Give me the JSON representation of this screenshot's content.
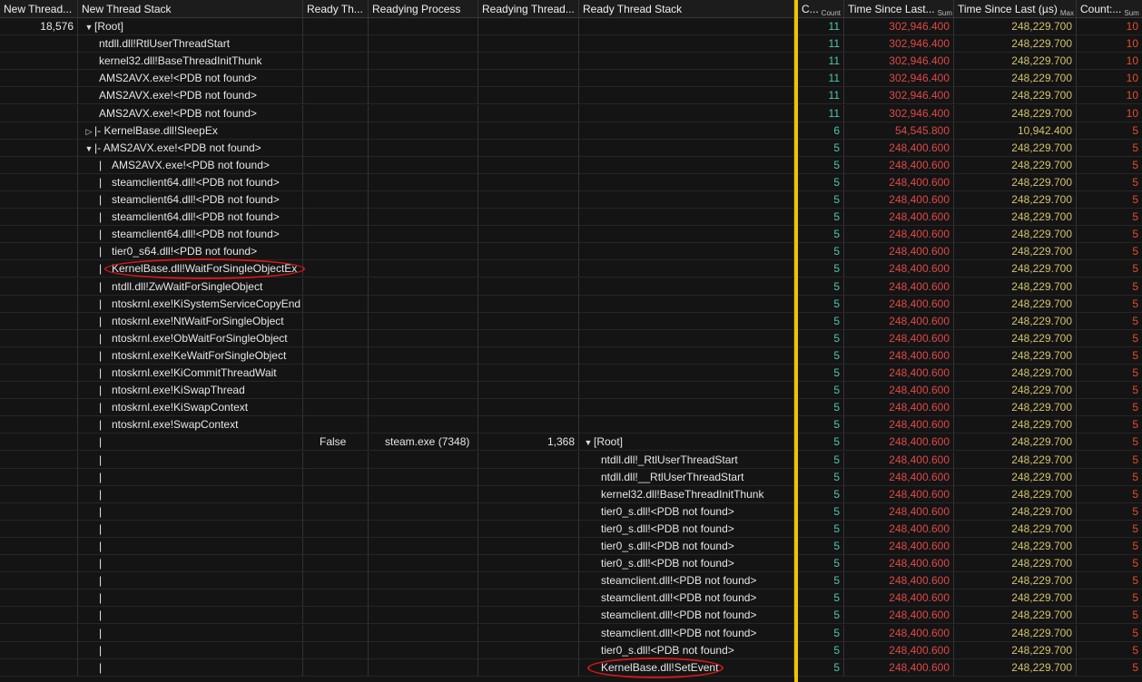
{
  "columns": {
    "new_thread": "New Thread...",
    "new_thread_stack": "New Thread Stack",
    "ready_thread": "Ready Th...",
    "readying_process": "Readying Process",
    "readying_thread": "Readying Thread...",
    "ready_thread_stack": "Ready Thread Stack",
    "count": "C...",
    "count_sub": "Count",
    "time_sum": "Time Since Last...",
    "time_sum_sub": "Sum",
    "time_max": "Time Since Last (µs)",
    "time_max_sub": "Max",
    "count_sum": "Count:...",
    "count_sum_sub": "Sum"
  },
  "rows": [
    {
      "nt": "18,576",
      "depth": 0,
      "pipe": false,
      "tw": "▼",
      "frame": "[Root]",
      "rt": "",
      "rp": "",
      "rth": "",
      "rtw": "",
      "rframe": "",
      "cnt": "11",
      "tsum": "302,946.400",
      "tmax": "248,229.700",
      "csum": "10"
    },
    {
      "nt": "",
      "depth": 1,
      "pipe": false,
      "tw": "",
      "frame": "ntdll.dll!RtlUserThreadStart",
      "rt": "",
      "rp": "",
      "rth": "",
      "rtw": "",
      "rframe": "",
      "cnt": "11",
      "tsum": "302,946.400",
      "tmax": "248,229.700",
      "csum": "10"
    },
    {
      "nt": "",
      "depth": 1,
      "pipe": false,
      "tw": "",
      "frame": "kernel32.dll!BaseThreadInitThunk",
      "rt": "",
      "rp": "",
      "rth": "",
      "rtw": "",
      "rframe": "",
      "cnt": "11",
      "tsum": "302,946.400",
      "tmax": "248,229.700",
      "csum": "10"
    },
    {
      "nt": "",
      "depth": 1,
      "pipe": false,
      "tw": "",
      "frame": "AMS2AVX.exe!<PDB not found>",
      "rt": "",
      "rp": "",
      "rth": "",
      "rtw": "",
      "rframe": "",
      "cnt": "11",
      "tsum": "302,946.400",
      "tmax": "248,229.700",
      "csum": "10"
    },
    {
      "nt": "",
      "depth": 1,
      "pipe": false,
      "tw": "",
      "frame": "AMS2AVX.exe!<PDB not found>",
      "rt": "",
      "rp": "",
      "rth": "",
      "rtw": "",
      "rframe": "",
      "cnt": "11",
      "tsum": "302,946.400",
      "tmax": "248,229.700",
      "csum": "10"
    },
    {
      "nt": "",
      "depth": 1,
      "pipe": false,
      "tw": "",
      "frame": "AMS2AVX.exe!<PDB not found>",
      "rt": "",
      "rp": "",
      "rth": "",
      "rtw": "",
      "rframe": "",
      "cnt": "11",
      "tsum": "302,946.400",
      "tmax": "248,229.700",
      "csum": "10"
    },
    {
      "nt": "",
      "depth": 0,
      "pipe": false,
      "tw": "▷",
      "frame": "|- KernelBase.dll!SleepEx",
      "rt": "",
      "rp": "",
      "rth": "",
      "rtw": "",
      "rframe": "",
      "cnt": "6",
      "tsum": "54,545.800",
      "tmax": "10,942.400",
      "csum": "5"
    },
    {
      "nt": "",
      "depth": 0,
      "pipe": false,
      "tw": "▼",
      "frame": "|- AMS2AVX.exe!<PDB not found>",
      "rt": "",
      "rp": "",
      "rth": "",
      "rtw": "",
      "rframe": "",
      "cnt": "5",
      "tsum": "248,400.600",
      "tmax": "248,229.700",
      "csum": "5"
    },
    {
      "nt": "",
      "depth": 1,
      "pipe": true,
      "tw": "",
      "frame": "AMS2AVX.exe!<PDB not found>",
      "rt": "",
      "rp": "",
      "rth": "",
      "rtw": "",
      "rframe": "",
      "cnt": "5",
      "tsum": "248,400.600",
      "tmax": "248,229.700",
      "csum": "5"
    },
    {
      "nt": "",
      "depth": 1,
      "pipe": true,
      "tw": "",
      "frame": "steamclient64.dll!<PDB not found>",
      "rt": "",
      "rp": "",
      "rth": "",
      "rtw": "",
      "rframe": "",
      "cnt": "5",
      "tsum": "248,400.600",
      "tmax": "248,229.700",
      "csum": "5"
    },
    {
      "nt": "",
      "depth": 1,
      "pipe": true,
      "tw": "",
      "frame": "steamclient64.dll!<PDB not found>",
      "rt": "",
      "rp": "",
      "rth": "",
      "rtw": "",
      "rframe": "",
      "cnt": "5",
      "tsum": "248,400.600",
      "tmax": "248,229.700",
      "csum": "5"
    },
    {
      "nt": "",
      "depth": 1,
      "pipe": true,
      "tw": "",
      "frame": "steamclient64.dll!<PDB not found>",
      "rt": "",
      "rp": "",
      "rth": "",
      "rtw": "",
      "rframe": "",
      "cnt": "5",
      "tsum": "248,400.600",
      "tmax": "248,229.700",
      "csum": "5"
    },
    {
      "nt": "",
      "depth": 1,
      "pipe": true,
      "tw": "",
      "frame": "steamclient64.dll!<PDB not found>",
      "rt": "",
      "rp": "",
      "rth": "",
      "rtw": "",
      "rframe": "",
      "cnt": "5",
      "tsum": "248,400.600",
      "tmax": "248,229.700",
      "csum": "5"
    },
    {
      "nt": "",
      "depth": 1,
      "pipe": true,
      "tw": "",
      "frame": "tier0_s64.dll!<PDB not found>",
      "rt": "",
      "rp": "",
      "rth": "",
      "rtw": "",
      "rframe": "",
      "cnt": "5",
      "tsum": "248,400.600",
      "tmax": "248,229.700",
      "csum": "5"
    },
    {
      "nt": "",
      "depth": 1,
      "pipe": true,
      "tw": "",
      "frame": "KernelBase.dll!WaitForSingleObjectEx",
      "rt": "",
      "rp": "",
      "rth": "",
      "rtw": "",
      "rframe": "",
      "cnt": "5",
      "tsum": "248,400.600",
      "tmax": "248,229.700",
      "csum": "5"
    },
    {
      "nt": "",
      "depth": 1,
      "pipe": true,
      "tw": "",
      "frame": "ntdll.dll!ZwWaitForSingleObject",
      "rt": "",
      "rp": "",
      "rth": "",
      "rtw": "",
      "rframe": "",
      "cnt": "5",
      "tsum": "248,400.600",
      "tmax": "248,229.700",
      "csum": "5"
    },
    {
      "nt": "",
      "depth": 1,
      "pipe": true,
      "tw": "",
      "frame": "ntoskrnl.exe!KiSystemServiceCopyEnd",
      "rt": "",
      "rp": "",
      "rth": "",
      "rtw": "",
      "rframe": "",
      "cnt": "5",
      "tsum": "248,400.600",
      "tmax": "248,229.700",
      "csum": "5"
    },
    {
      "nt": "",
      "depth": 1,
      "pipe": true,
      "tw": "",
      "frame": "ntoskrnl.exe!NtWaitForSingleObject",
      "rt": "",
      "rp": "",
      "rth": "",
      "rtw": "",
      "rframe": "",
      "cnt": "5",
      "tsum": "248,400.600",
      "tmax": "248,229.700",
      "csum": "5"
    },
    {
      "nt": "",
      "depth": 1,
      "pipe": true,
      "tw": "",
      "frame": "ntoskrnl.exe!ObWaitForSingleObject",
      "rt": "",
      "rp": "",
      "rth": "",
      "rtw": "",
      "rframe": "",
      "cnt": "5",
      "tsum": "248,400.600",
      "tmax": "248,229.700",
      "csum": "5"
    },
    {
      "nt": "",
      "depth": 1,
      "pipe": true,
      "tw": "",
      "frame": "ntoskrnl.exe!KeWaitForSingleObject",
      "rt": "",
      "rp": "",
      "rth": "",
      "rtw": "",
      "rframe": "",
      "cnt": "5",
      "tsum": "248,400.600",
      "tmax": "248,229.700",
      "csum": "5"
    },
    {
      "nt": "",
      "depth": 1,
      "pipe": true,
      "tw": "",
      "frame": "ntoskrnl.exe!KiCommitThreadWait",
      "rt": "",
      "rp": "",
      "rth": "",
      "rtw": "",
      "rframe": "",
      "cnt": "5",
      "tsum": "248,400.600",
      "tmax": "248,229.700",
      "csum": "5"
    },
    {
      "nt": "",
      "depth": 1,
      "pipe": true,
      "tw": "",
      "frame": "ntoskrnl.exe!KiSwapThread",
      "rt": "",
      "rp": "",
      "rth": "",
      "rtw": "",
      "rframe": "",
      "cnt": "5",
      "tsum": "248,400.600",
      "tmax": "248,229.700",
      "csum": "5"
    },
    {
      "nt": "",
      "depth": 1,
      "pipe": true,
      "tw": "",
      "frame": "ntoskrnl.exe!KiSwapContext",
      "rt": "",
      "rp": "",
      "rth": "",
      "rtw": "",
      "rframe": "",
      "cnt": "5",
      "tsum": "248,400.600",
      "tmax": "248,229.700",
      "csum": "5"
    },
    {
      "nt": "",
      "depth": 1,
      "pipe": true,
      "tw": "",
      "frame": "ntoskrnl.exe!SwapContext",
      "rt": "",
      "rp": "",
      "rth": "",
      "rtw": "",
      "rframe": "",
      "cnt": "5",
      "tsum": "248,400.600",
      "tmax": "248,229.700",
      "csum": "5"
    },
    {
      "nt": "",
      "depth": 1,
      "pipe": true,
      "tw": "",
      "frame": "",
      "rt": "False",
      "rp": "steam.exe (7348)",
      "rth": "1,368",
      "rtw": "▼",
      "rframe": "[Root]",
      "cnt": "5",
      "tsum": "248,400.600",
      "tmax": "248,229.700",
      "csum": "5"
    },
    {
      "nt": "",
      "depth": 1,
      "pipe": true,
      "tw": "",
      "frame": "",
      "rt": "",
      "rp": "",
      "rth": "",
      "rtw": "",
      "rframe": "ntdll.dll!_RtlUserThreadStart",
      "cnt": "5",
      "tsum": "248,400.600",
      "tmax": "248,229.700",
      "csum": "5"
    },
    {
      "nt": "",
      "depth": 1,
      "pipe": true,
      "tw": "",
      "frame": "",
      "rt": "",
      "rp": "",
      "rth": "",
      "rtw": "",
      "rframe": "ntdll.dll!__RtlUserThreadStart",
      "cnt": "5",
      "tsum": "248,400.600",
      "tmax": "248,229.700",
      "csum": "5"
    },
    {
      "nt": "",
      "depth": 1,
      "pipe": true,
      "tw": "",
      "frame": "",
      "rt": "",
      "rp": "",
      "rth": "",
      "rtw": "",
      "rframe": "kernel32.dll!BaseThreadInitThunk",
      "cnt": "5",
      "tsum": "248,400.600",
      "tmax": "248,229.700",
      "csum": "5"
    },
    {
      "nt": "",
      "depth": 1,
      "pipe": true,
      "tw": "",
      "frame": "",
      "rt": "",
      "rp": "",
      "rth": "",
      "rtw": "",
      "rframe": "tier0_s.dll!<PDB not found>",
      "cnt": "5",
      "tsum": "248,400.600",
      "tmax": "248,229.700",
      "csum": "5"
    },
    {
      "nt": "",
      "depth": 1,
      "pipe": true,
      "tw": "",
      "frame": "",
      "rt": "",
      "rp": "",
      "rth": "",
      "rtw": "",
      "rframe": "tier0_s.dll!<PDB not found>",
      "cnt": "5",
      "tsum": "248,400.600",
      "tmax": "248,229.700",
      "csum": "5"
    },
    {
      "nt": "",
      "depth": 1,
      "pipe": true,
      "tw": "",
      "frame": "",
      "rt": "",
      "rp": "",
      "rth": "",
      "rtw": "",
      "rframe": "tier0_s.dll!<PDB not found>",
      "cnt": "5",
      "tsum": "248,400.600",
      "tmax": "248,229.700",
      "csum": "5"
    },
    {
      "nt": "",
      "depth": 1,
      "pipe": true,
      "tw": "",
      "frame": "",
      "rt": "",
      "rp": "",
      "rth": "",
      "rtw": "",
      "rframe": "tier0_s.dll!<PDB not found>",
      "cnt": "5",
      "tsum": "248,400.600",
      "tmax": "248,229.700",
      "csum": "5"
    },
    {
      "nt": "",
      "depth": 1,
      "pipe": true,
      "tw": "",
      "frame": "",
      "rt": "",
      "rp": "",
      "rth": "",
      "rtw": "",
      "rframe": "steamclient.dll!<PDB not found>",
      "cnt": "5",
      "tsum": "248,400.600",
      "tmax": "248,229.700",
      "csum": "5"
    },
    {
      "nt": "",
      "depth": 1,
      "pipe": true,
      "tw": "",
      "frame": "",
      "rt": "",
      "rp": "",
      "rth": "",
      "rtw": "",
      "rframe": "steamclient.dll!<PDB not found>",
      "cnt": "5",
      "tsum": "248,400.600",
      "tmax": "248,229.700",
      "csum": "5"
    },
    {
      "nt": "",
      "depth": 1,
      "pipe": true,
      "tw": "",
      "frame": "",
      "rt": "",
      "rp": "",
      "rth": "",
      "rtw": "",
      "rframe": "steamclient.dll!<PDB not found>",
      "cnt": "5",
      "tsum": "248,400.600",
      "tmax": "248,229.700",
      "csum": "5"
    },
    {
      "nt": "",
      "depth": 1,
      "pipe": true,
      "tw": "",
      "frame": "",
      "rt": "",
      "rp": "",
      "rth": "",
      "rtw": "",
      "rframe": "steamclient.dll!<PDB not found>",
      "cnt": "5",
      "tsum": "248,400.600",
      "tmax": "248,229.700",
      "csum": "5"
    },
    {
      "nt": "",
      "depth": 1,
      "pipe": true,
      "tw": "",
      "frame": "",
      "rt": "",
      "rp": "",
      "rth": "",
      "rtw": "",
      "rframe": "tier0_s.dll!<PDB not found>",
      "cnt": "5",
      "tsum": "248,400.600",
      "tmax": "248,229.700",
      "csum": "5"
    },
    {
      "nt": "",
      "depth": 1,
      "pipe": true,
      "tw": "",
      "frame": "",
      "rt": "",
      "rp": "",
      "rth": "",
      "rtw": "",
      "rframe": "KernelBase.dll!SetEvent",
      "cnt": "5",
      "tsum": "248,400.600",
      "tmax": "248,229.700",
      "csum": "5"
    }
  ],
  "highlights": [
    {
      "row": 14,
      "column": "new_thread_stack",
      "color": "#d01818"
    },
    {
      "row": 37,
      "column": "ready_thread_stack",
      "color": "#d01818"
    }
  ],
  "colors": {
    "count": "#4fc6b4",
    "time_sum": "#e04848",
    "time_max": "#d2c26c",
    "count_sum": "#e0502a",
    "splitter": "#f0c400"
  }
}
